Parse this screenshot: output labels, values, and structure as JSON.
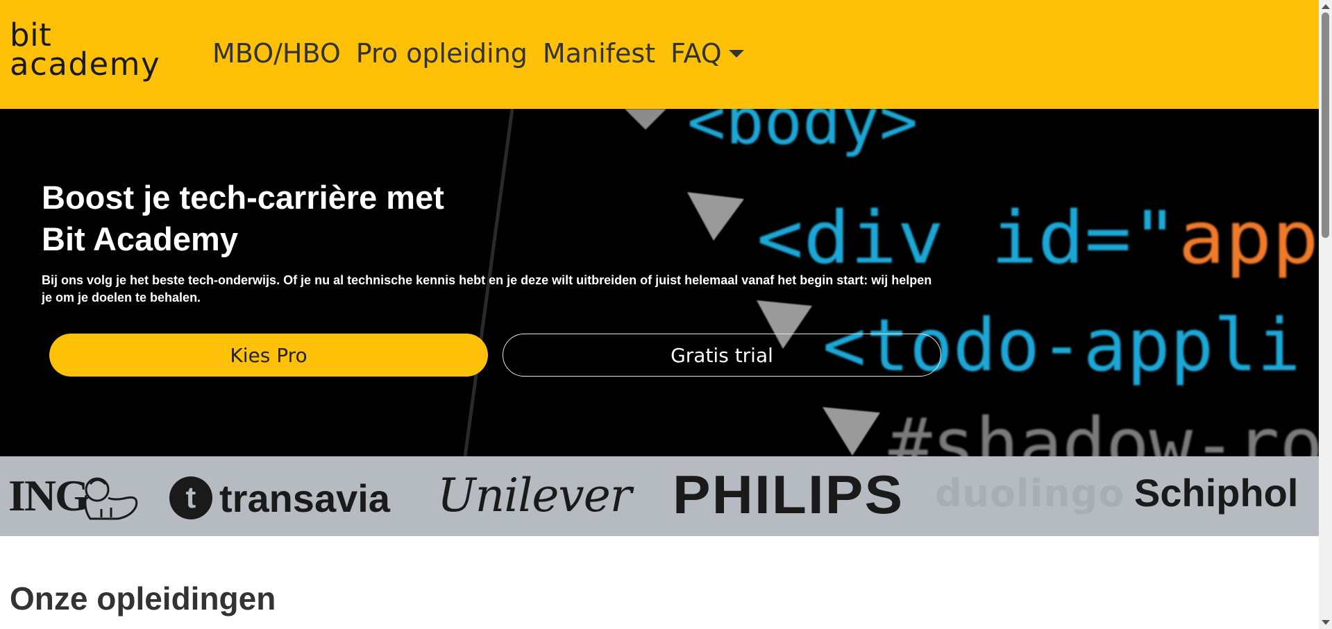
{
  "navbar": {
    "logo_line1": "bit",
    "logo_line2": "academy",
    "links": [
      "MBO/HBO",
      "Pro opleiding",
      "Manifest",
      "FAQ"
    ]
  },
  "hero": {
    "title_line1": "Boost je tech-carrière met",
    "title_line2": "Bit Academy",
    "text": "Bij ons volg je het beste tech-onderwijs. Of je nu al technische kennis hebt en je deze wilt uitbreiden of juist helemaal vanaf het begin start: wij helpen je om je doelen te behalen.",
    "btn_pro": "Kies Pro",
    "btn_trial": "Gratis trial",
    "code_lines": [
      "<body>",
      "<div id=\"app",
      "<todo-appli",
      "#shadow-ro"
    ]
  },
  "partners": {
    "ing": "ING",
    "transavia": "transavia",
    "transavia_mark": "t",
    "unilever": "Unilever",
    "philips": "PHILIPS",
    "duolingo": "duolingo",
    "schiphol": "Schiphol"
  },
  "section": {
    "title": "Onze opleidingen"
  },
  "colors": {
    "brand_yellow": "#ffc107",
    "hero_bg": "#000000",
    "partners_bg": "#b5bbc1",
    "code_blue": "#1fa7d6",
    "code_orange": "#f07a2a"
  },
  "icons": {
    "faq_dropdown": "caret-down-icon",
    "ing_lion": "lion-icon"
  }
}
